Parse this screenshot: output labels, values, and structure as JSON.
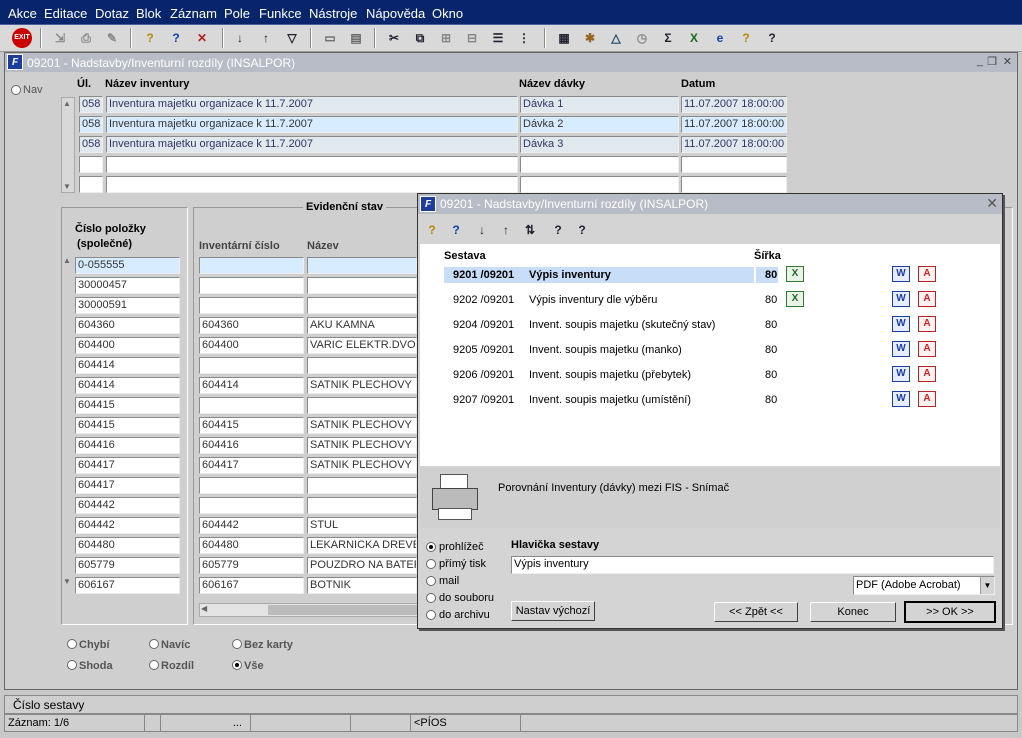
{
  "menu": [
    {
      "label": "Akce"
    },
    {
      "label": "Editace"
    },
    {
      "label": "Dotaz"
    },
    {
      "label": "Blok"
    },
    {
      "label": "Záznam"
    },
    {
      "label": "Pole"
    },
    {
      "label": "Funkce"
    },
    {
      "label": "Nástroje"
    },
    {
      "label": "Nápověda"
    },
    {
      "label": "Okno"
    }
  ],
  "toolbar": {
    "exit_label": "EXIT"
  },
  "main": {
    "title": "09201 - Nadstavby/Inventurní rozdíly (INSALPOR)",
    "nav_label": "Nav",
    "headers": {
      "ul": "Úl.",
      "name": "Název inventury",
      "batch": "Název dávky",
      "date": "Datum"
    },
    "rows": [
      {
        "ul": "058",
        "name": "Inventura majetku organizace k 11.7.2007",
        "batch": "Dávka 1",
        "date": "11.07.2007 18:00:00"
      },
      {
        "ul": "058",
        "name": "Inventura majetku organizace k 11.7.2007",
        "batch": "Dávka 2",
        "date": "11.07.2007 18:00:00"
      },
      {
        "ul": "058",
        "name": "Inventura majetku organizace k 11.7.2007",
        "batch": "Dávka 3",
        "date": "11.07.2007 18:00:00"
      },
      {
        "ul": "",
        "name": "",
        "batch": "",
        "date": ""
      },
      {
        "ul": "",
        "name": "",
        "batch": "",
        "date": ""
      }
    ],
    "detail": {
      "item_header_1": "Číslo položky",
      "item_header_2": "(společné)",
      "group_title": "Evidenční stav",
      "inv_header": "Inventární číslo",
      "name_header": "Název",
      "rows": [
        {
          "item": "0-055555",
          "inv": "",
          "name": ""
        },
        {
          "item": "30000457",
          "inv": "",
          "name": ""
        },
        {
          "item": "30000591",
          "inv": "",
          "name": ""
        },
        {
          "item": "604360",
          "inv": "604360",
          "name": "AKU KAMNA"
        },
        {
          "item": "604400",
          "inv": "604400",
          "name": "VARIC ELEKTR.DVOU"
        },
        {
          "item": "604414",
          "inv": "",
          "name": ""
        },
        {
          "item": "604414",
          "inv": "604414",
          "name": "SATNIK PLECHOVY"
        },
        {
          "item": "604415",
          "inv": "",
          "name": ""
        },
        {
          "item": "604415",
          "inv": "604415",
          "name": "SATNIK PLECHOVY"
        },
        {
          "item": "604416",
          "inv": "604416",
          "name": "SATNIK PLECHOVY"
        },
        {
          "item": "604417",
          "inv": "604417",
          "name": "SATNIK PLECHOVY"
        },
        {
          "item": "604417",
          "inv": "",
          "name": ""
        },
        {
          "item": "604442",
          "inv": "",
          "name": ""
        },
        {
          "item": "604442",
          "inv": "604442",
          "name": "STUL"
        },
        {
          "item": "604480",
          "inv": "604480",
          "name": "LEKARNICKA DREVE"
        },
        {
          "item": "605779",
          "inv": "605779",
          "name": "POUZDRO NA BATER"
        },
        {
          "item": "606167",
          "inv": "606167",
          "name": "BOTNIK"
        }
      ]
    },
    "filters": [
      {
        "label": "Chybí",
        "checked": false
      },
      {
        "label": "Navíc",
        "checked": false
      },
      {
        "label": "Bez karty",
        "checked": false
      },
      {
        "label": "Shoda",
        "checked": false
      },
      {
        "label": "Rozdíl",
        "checked": false
      },
      {
        "label": "Vše",
        "checked": true
      }
    ]
  },
  "dialog": {
    "title": "09201 - Nadstavby/Inventurní rozdíly (INSALPOR)",
    "col_report": "Sestava",
    "col_width": "Šířka",
    "reports": [
      {
        "code": "9201  /09201",
        "name": "Výpis inventury",
        "width": "80",
        "excel": true,
        "selected": true
      },
      {
        "code": "9202  /09201",
        "name": "Výpis inventury dle výběru",
        "width": "80",
        "excel": true,
        "selected": false
      },
      {
        "code": "9204  /09201",
        "name": "Invent. soupis majetku (skutečný stav)",
        "width": "80",
        "excel": false,
        "selected": false
      },
      {
        "code": "9205  /09201",
        "name": "Invent. soupis majetku (manko)",
        "width": "80",
        "excel": false,
        "selected": false
      },
      {
        "code": "9206  /09201",
        "name": "Invent. soupis majetku (přebytek)",
        "width": "80",
        "excel": false,
        "selected": false
      },
      {
        "code": "9207  /09201",
        "name": "Invent. soupis majetku (umístění)",
        "width": "80",
        "excel": false,
        "selected": false
      }
    ],
    "description": "Porovnání Inventury (dávky) mezi FIS - Snímač",
    "outputs": [
      {
        "label": "prohlížeč",
        "checked": true
      },
      {
        "label": "přímý tisk",
        "checked": false
      },
      {
        "label": "mail",
        "checked": false
      },
      {
        "label": "do souboru",
        "checked": false
      },
      {
        "label": "do archivu",
        "checked": false
      }
    ],
    "header_label": "Hlavička sestavy",
    "header_value": "Výpis inventury",
    "format_value": "PDF (Adobe Acrobat)",
    "btn_default": "Nastav výchozí",
    "btn_back": "<< Zpět <<",
    "btn_end": "Konec",
    "btn_ok": ">> OK >>"
  },
  "status": {
    "field_name": "Číslo sestavy",
    "record": "Záznam: 1/6",
    "ellipsis": "...",
    "mode": "<PÍOS"
  }
}
